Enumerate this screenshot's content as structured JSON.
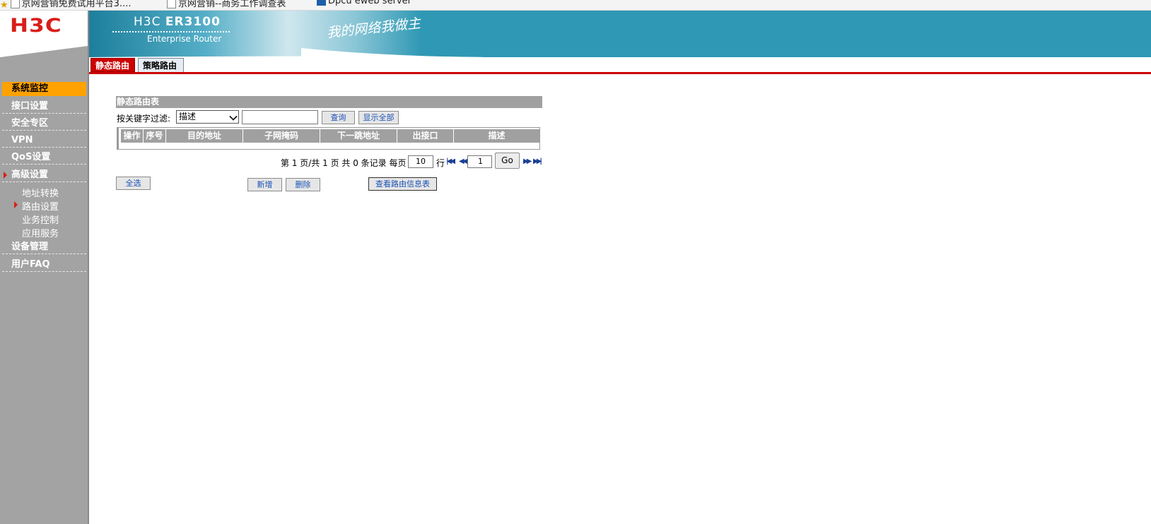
{
  "bookmarks": [
    {
      "label": "京网营销免费试用平台3.... ",
      "icon": "page-icon"
    },
    {
      "label": "京网营销--商务工作调查表",
      "icon": "page-icon"
    },
    {
      "label": "Dpcu eweb server",
      "icon": "app-icon"
    }
  ],
  "brand": {
    "logo": "H3C",
    "model_prefix": "H3C",
    "model_name": "ER3100",
    "model_sub": "Enterprise Router",
    "slogan": "我的网络我做主"
  },
  "sidebar": {
    "items": [
      {
        "label": "系统监控",
        "active": true
      },
      {
        "label": "接口设置"
      },
      {
        "label": "安全专区"
      },
      {
        "label": "VPN"
      },
      {
        "label": "QoS设置"
      },
      {
        "label": "高级设置",
        "expanded": true
      },
      {
        "label": "设备管理"
      },
      {
        "label": "用户FAQ"
      }
    ],
    "sub_items": [
      {
        "label": "地址转换"
      },
      {
        "label": "路由设置",
        "current": true
      },
      {
        "label": "业务控制"
      },
      {
        "label": "应用服务"
      }
    ]
  },
  "tabs": [
    {
      "label": "静态路由",
      "active": true
    },
    {
      "label": "策略路由"
    }
  ],
  "panel": {
    "title": "静态路由表",
    "filter_label": "按关键字过滤:",
    "filter_selected": "描述",
    "filter_value": "",
    "query_button": "查询",
    "show_all_button": "显示全部",
    "columns": [
      "操作",
      "序号",
      "目的地址",
      "子网掩码",
      "下一跳地址",
      "出接口",
      "描述"
    ],
    "rows": []
  },
  "pager": {
    "summary": "第 1 页/共 1 页 共 0 条记录 每页",
    "per_page": "10",
    "per_page_unit": "行",
    "page": "1",
    "go_button": "Go"
  },
  "actions": {
    "select_all": "全选",
    "add": "新增",
    "delete": "删除",
    "view_route_table": "查看路由信息表"
  },
  "colors": {
    "brand_red": "#d91e18",
    "banner_teal": "#2f98b4",
    "sidebar_gray": "#a3a3a3",
    "active_orange": "#ffa200",
    "tab_red": "#cc0000"
  }
}
